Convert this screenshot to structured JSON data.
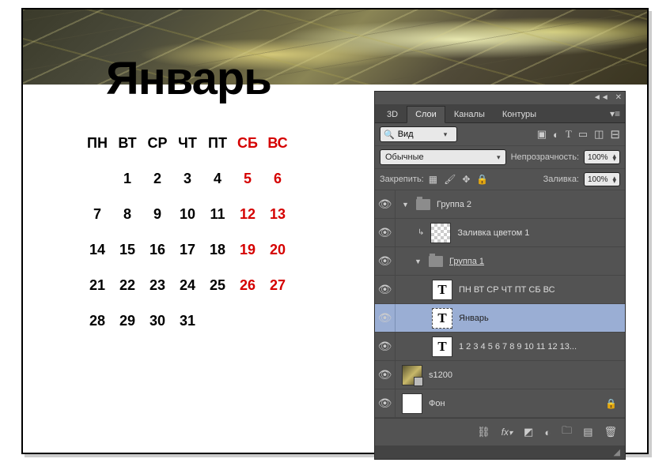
{
  "month_title": "Январь",
  "weekdays": [
    "ПН",
    "ВТ",
    "СР",
    "ЧТ",
    "ПТ",
    "СБ",
    "ВС"
  ],
  "weeks": [
    [
      "",
      "1",
      "2",
      "3",
      "4",
      "5",
      "6"
    ],
    [
      "7",
      "8",
      "9",
      "10",
      "11",
      "12",
      "13"
    ],
    [
      "14",
      "15",
      "16",
      "17",
      "18",
      "19",
      "20"
    ],
    [
      "21",
      "22",
      "23",
      "24",
      "25",
      "26",
      "27"
    ],
    [
      "28",
      "29",
      "30",
      "31",
      "",
      "",
      ""
    ]
  ],
  "panel": {
    "tabs": {
      "t1": "3D",
      "t2": "Слои",
      "t3": "Каналы",
      "t4": "Контуры"
    },
    "search_placeholder": "Вид",
    "blend_mode": "Обычные",
    "opacity_label": "Непрозрачность:",
    "opacity_value": "100%",
    "lock_label": "Закрепить:",
    "fill_label": "Заливка:",
    "fill_value": "100%",
    "layers": {
      "group2": "Группа 2",
      "colorfill": "Заливка цветом 1",
      "group1": "Группа 1",
      "weekdays_text": "ПН ВТ СР ЧТ ПТ СБ ВС",
      "month": "Январь",
      "numbers": "1 2 3 4 5 6 7 8 9 10 11 12 13...",
      "s1200": "s1200",
      "bg": "Фон"
    }
  }
}
